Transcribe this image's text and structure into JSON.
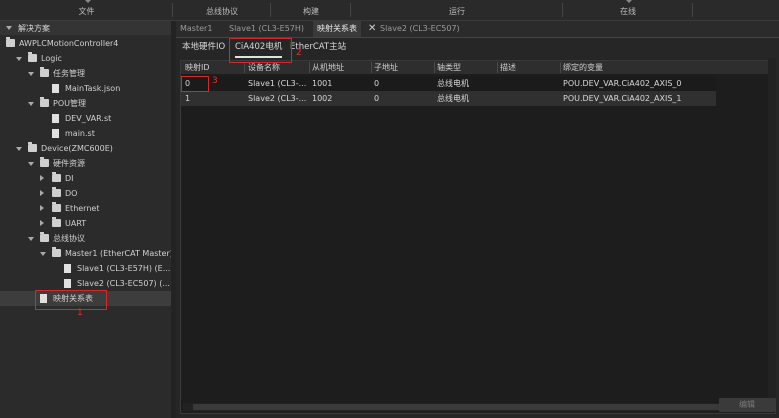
{
  "menubar": {
    "items": [
      "文件",
      "总线协议",
      "构建",
      "运行",
      "在线"
    ]
  },
  "left_panel": {
    "header": "解决方案",
    "tree": [
      {
        "label": "AWPLCMotionController4",
        "level": 0,
        "icon": "project-icon"
      },
      {
        "label": "Logic",
        "level": 1,
        "icon": "logic-icon",
        "expanded": true
      },
      {
        "label": "任务管理",
        "level": 2,
        "icon": "folder-icon",
        "expanded": true
      },
      {
        "label": "MainTask.json",
        "level": 3,
        "icon": "file-icon"
      },
      {
        "label": "POU管理",
        "level": 2,
        "icon": "folder-icon",
        "expanded": true
      },
      {
        "label": "DEV_VAR.st",
        "level": 3,
        "icon": "file-icon"
      },
      {
        "label": "main.st",
        "level": 3,
        "icon": "file-icon"
      },
      {
        "label": "Device(ZMC600E)",
        "level": 1,
        "icon": "device-icon",
        "expanded": true
      },
      {
        "label": "硬件资源",
        "level": 2,
        "icon": "folder-icon",
        "expanded": true
      },
      {
        "label": "DI",
        "level": 3,
        "icon": "folder-icon",
        "expanded": false
      },
      {
        "label": "DO",
        "level": 3,
        "icon": "folder-icon",
        "expanded": false
      },
      {
        "label": "Ethernet",
        "level": 3,
        "icon": "folder-icon",
        "expanded": false
      },
      {
        "label": "UART",
        "level": 3,
        "icon": "folder-icon",
        "expanded": false
      },
      {
        "label": "总线协议",
        "level": 2,
        "icon": "folder-icon",
        "expanded": true
      },
      {
        "label": "Master1 (EtherCAT Master)",
        "level": 3,
        "icon": "master-icon",
        "expanded": true
      },
      {
        "label": "Slave1 (CL3-E57H) (E...",
        "level": 4,
        "icon": "slave-icon"
      },
      {
        "label": "Slave2 (CL3-EC507) (...",
        "level": 4,
        "icon": "slave-icon"
      },
      {
        "label": "映射关系表",
        "level": 2,
        "icon": "table-icon",
        "selected": true
      }
    ],
    "annotation": "1"
  },
  "tabs": [
    {
      "label": "Master1",
      "active": false
    },
    {
      "label": "Slave1 (CL3-E57H)",
      "active": false
    },
    {
      "label": "映射关系表",
      "active": true
    },
    {
      "label": "Slave2 (CL3-EC507)",
      "active": false
    }
  ],
  "subtabs": [
    {
      "label": "本地硬件IO",
      "active": false
    },
    {
      "label": "CiA402电机",
      "active": true
    },
    {
      "label": "EtherCAT主站",
      "active": false
    }
  ],
  "subtab_annotation": "2",
  "grid": {
    "columns": [
      "映射ID",
      "设备名称",
      "从机地址",
      "子地址",
      "轴类型",
      "描述",
      "绑定的变量"
    ],
    "rows": [
      [
        "0",
        "Slave1 (CL3-...",
        "1001",
        "0",
        "总线电机",
        "",
        "POU.DEV_VAR.CiA402_AXIS_0"
      ],
      [
        "1",
        "Slave2 (CL3-...",
        "1002",
        "0",
        "总线电机",
        "",
        "POU.DEV_VAR.CiA402_AXIS_1"
      ]
    ],
    "annotation": "3"
  },
  "edit_button": "编辑",
  "colors": {
    "annotation": "#d62828",
    "background": "#1f1f1f"
  }
}
